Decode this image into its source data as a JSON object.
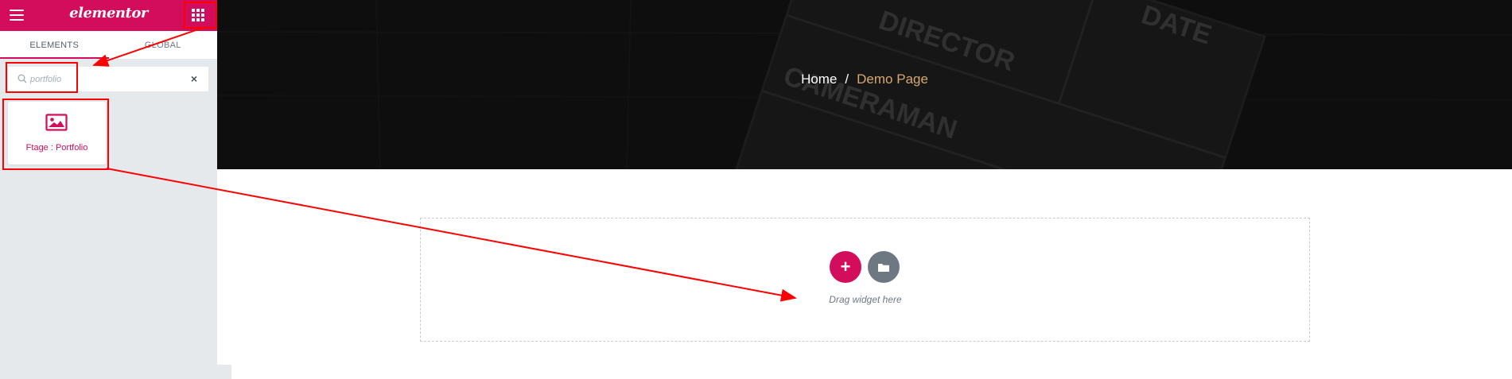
{
  "sidebar": {
    "logo": "elementor",
    "menu_icon": "hamburger-icon",
    "grid_icon": "grid-icon",
    "tabs": [
      {
        "label": "ELEMENTS",
        "active": true
      },
      {
        "label": "GLOBAL",
        "active": false
      }
    ],
    "search": {
      "value": "portfolio",
      "clear_icon": "close-icon"
    },
    "widgets": [
      {
        "label": "Ftage : Portfolio",
        "icon": "image-icon"
      }
    ]
  },
  "hero": {
    "breadcrumb": {
      "home": "Home",
      "separator": "/",
      "current": "Demo Page"
    },
    "background_words": [
      "DIRECTOR",
      "DATE",
      "CAMERAMAN"
    ]
  },
  "canvas": {
    "drop_zone_text": "Drag widget here",
    "add_icon": "plus-icon",
    "template_icon": "folder-icon"
  },
  "colors": {
    "accent": "#d30c5c",
    "sidebar_bg": "#e6e9ec",
    "breadcrumb_current": "#d7a86e",
    "annotation": "#ff0000"
  }
}
